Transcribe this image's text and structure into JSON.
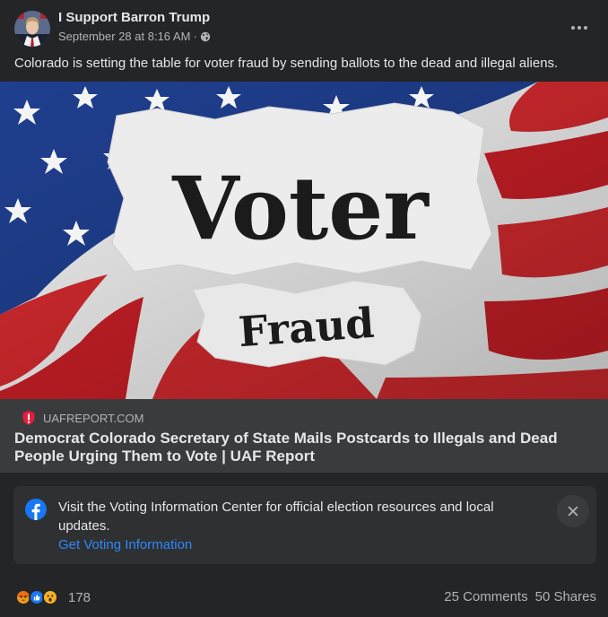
{
  "post": {
    "page_name": "I Support Barron Trump",
    "date": "September 28 at 8:16 AM",
    "separator": "·",
    "privacy_icon": "globe-icon",
    "more_icon": "more-dots-icon",
    "caption": "Colorado is setting the table for voter fraud by sending ballots to the dead and illegal aliens."
  },
  "link_card": {
    "image_text_main": "Voter",
    "image_text_sub": "Fraud",
    "domain": "UAFREPORT.COM",
    "title": "Democrat Colorado Secretary of State Mails Postcards to Illegals and Dead People Urging Them to Vote | UAF Report"
  },
  "voting_info": {
    "icon": "facebook-icon",
    "text": "Visit the Voting Information Center for official election resources and local updates.",
    "link_label": "Get Voting Information",
    "close_icon": "close-icon"
  },
  "footer": {
    "reactions": [
      "angry",
      "like",
      "wow"
    ],
    "reaction_count": "178",
    "comments": "25 Comments",
    "shares": "50 Shares"
  },
  "colors": {
    "background": "#242526",
    "card": "#3a3b3c",
    "link_blue": "#2d88ff",
    "text_primary": "#e4e6eb",
    "text_secondary": "#b0b3b8"
  }
}
